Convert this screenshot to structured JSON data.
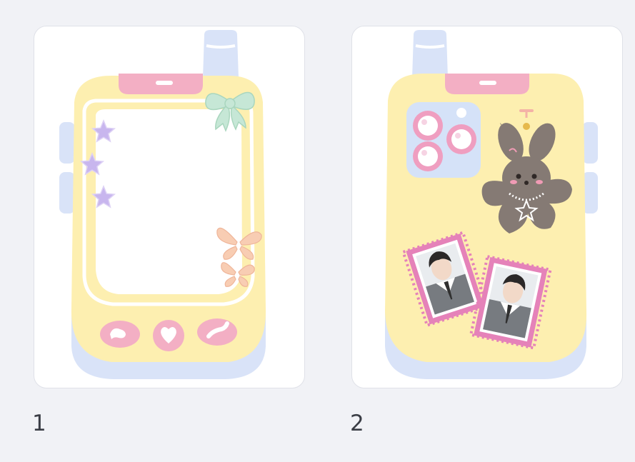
{
  "items": [
    {
      "number": "1",
      "image_name": "flip-phone-case-template-front",
      "colors": {
        "body": "#fdefb0",
        "antenna": "#d9e3f8",
        "side_buttons": "#d9e3f8",
        "top_notch": "#f3afc4",
        "screen_frame": "#ffffff",
        "stars": "#c8b6ee",
        "bow": "#c6e7d6",
        "butterflies": "#f8cdb3",
        "keys": "#f3afc4"
      }
    },
    {
      "number": "2",
      "image_name": "flip-phone-case-back-with-bear-and-photo-cards",
      "colors": {
        "body": "#fdefb0",
        "antenna": "#d9e3f8",
        "side_buttons": "#d9e3f8",
        "top_notch": "#f3afc4",
        "camera_module": "#d5e2f8",
        "lens_ring": "#ef9ec0",
        "bear": "#857a74",
        "stamp_border": "#e582b9"
      }
    }
  ]
}
